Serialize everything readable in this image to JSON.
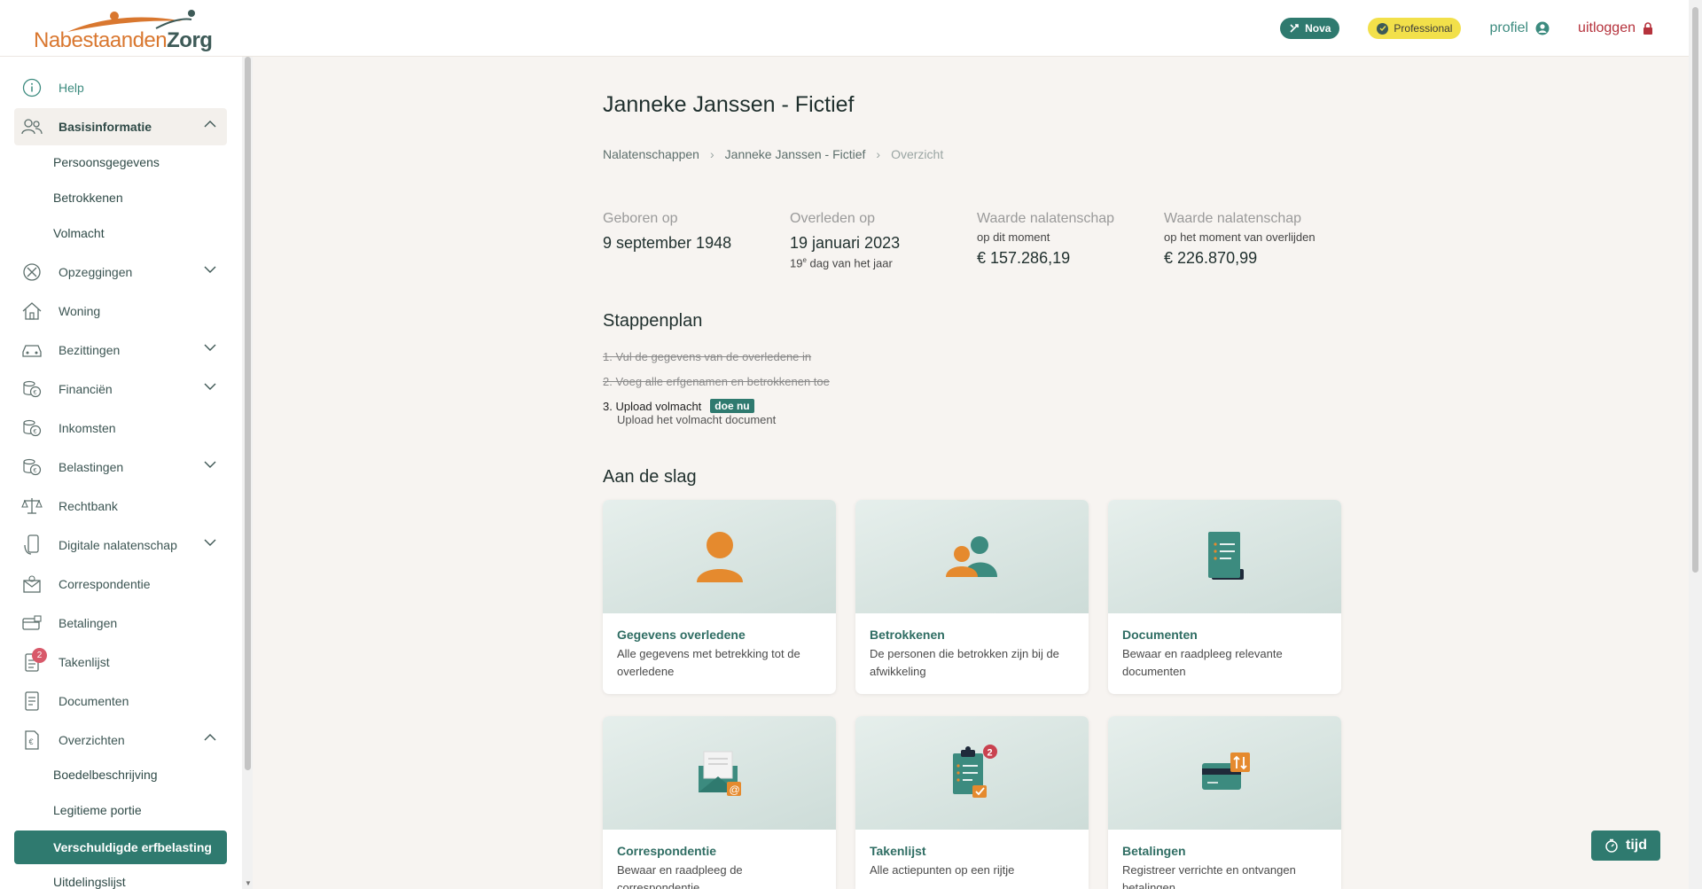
{
  "header": {
    "logo_part1": "Nabestaanden",
    "logo_part2": "Zorg",
    "badge_nova": "Nova",
    "badge_professional": "Professional",
    "profile_label": "profiel",
    "logout_label": "uitloggen"
  },
  "sidebar": {
    "help": "Help",
    "basisinformatie": "Basisinformatie",
    "persoonsgegevens": "Persoonsgegevens",
    "betrokkenen": "Betrokkenen",
    "volmacht": "Volmacht",
    "opzeggingen": "Opzeggingen",
    "woning": "Woning",
    "bezittingen": "Bezittingen",
    "financien": "Financiën",
    "inkomsten": "Inkomsten",
    "belastingen": "Belastingen",
    "rechtbank": "Rechtbank",
    "digitale_nalatenschap": "Digitale nalatenschap",
    "correspondentie": "Correspondentie",
    "betalingen": "Betalingen",
    "takenlijst": "Takenlijst",
    "takenlijst_badge": "2",
    "documenten": "Documenten",
    "overzichten": "Overzichten",
    "boedelbeschrijving": "Boedelbeschrijving",
    "legitieme_portie": "Legitieme portie",
    "verschuldigde_erfbelasting": "Verschuldigde erfbelasting",
    "uitdelingslijst": "Uitdelingslijst"
  },
  "main": {
    "title": "Janneke Janssen - Fictief",
    "breadcrumb": [
      "Nalatenschappen",
      "Janneke Janssen - Fictief",
      "Overzicht"
    ],
    "stats": {
      "born_label": "Geboren op",
      "born_value": "9 september 1948",
      "died_label": "Overleden op",
      "died_value": "19 januari 2023",
      "died_note_num": "19",
      "died_note_sup": "e",
      "died_note_rest": " dag van het jaar",
      "value_now_label": "Waarde nalatenschap",
      "value_now_sub": "op dit moment",
      "value_now": "€ 157.286,19",
      "value_death_label": "Waarde nalatenschap",
      "value_death_sub": "op het moment van overlijden",
      "value_death": "€ 226.870,99"
    },
    "stappenplan_title": "Stappenplan",
    "steps": [
      {
        "text": "1. Vul de gegevens van de overledene in"
      },
      {
        "text": "2. Voeg alle erfgenamen en betrokkenen toe"
      },
      {
        "text": "3. Upload volmacht",
        "action": "doe nu",
        "desc": "Upload het volmacht document"
      }
    ],
    "aan_de_slag_title": "Aan de slag",
    "cards": [
      {
        "title": "Gegevens overledene",
        "desc": "Alle gegevens met betrekking tot de overledene"
      },
      {
        "title": "Betrokkenen",
        "desc": "De personen die betrokken zijn bij de afwikkeling"
      },
      {
        "title": "Documenten",
        "desc": "Bewaar en raadpleeg relevante documenten"
      },
      {
        "title": "Correspondentie",
        "desc": "Bewaar en raadpleeg de correspondentie"
      },
      {
        "title": "Takenlijst",
        "desc": "Alle actiepunten op een rijtje",
        "badge": "2"
      },
      {
        "title": "Betalingen",
        "desc": "Registreer verrichte en ontvangen betalingen"
      }
    ],
    "tijd_label": "tijd"
  },
  "colors": {
    "brand_green": "#2f7a6f",
    "brand_orange": "#e58a2e",
    "logout_red": "#b5323c",
    "pro_yellow": "#f2e04a"
  }
}
